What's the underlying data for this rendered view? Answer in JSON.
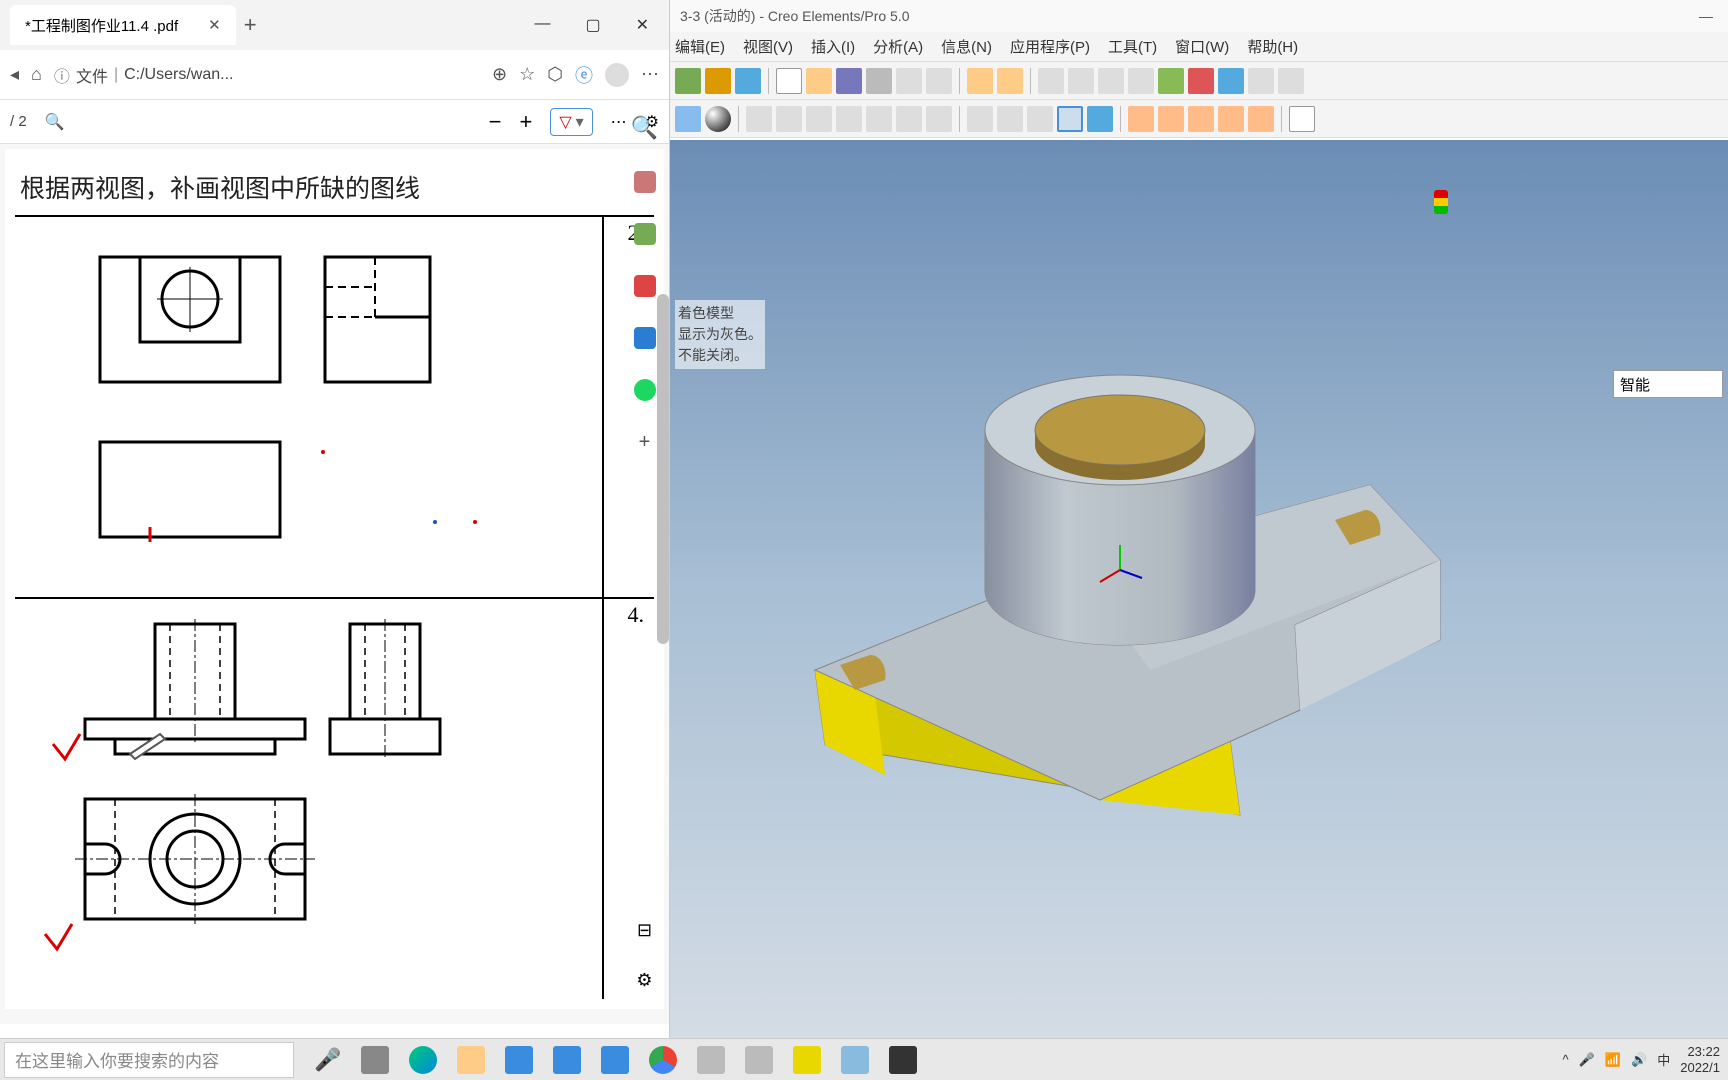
{
  "pdf": {
    "tab_title": "*工程制图作业11.4 .pdf",
    "address_prefix": "文件",
    "address_path": "C:/Users/wan...",
    "page_indicator": "/ 2",
    "heading": "根据两视图，补画视图中所缺的图线",
    "problem_2": "2.",
    "problem_4": "4."
  },
  "creo": {
    "title": "3-3 (活动的) - Creo Elements/Pro 5.0",
    "menus": [
      "编辑(E)",
      "视图(V)",
      "插入(I)",
      "分析(A)",
      "信息(N)",
      "应用程序(P)",
      "工具(T)",
      "窗口(W)",
      "帮助(H)"
    ],
    "info_line1": "着色模型",
    "info_line2": "显示为灰色。",
    "info_line3": "不能关闭。",
    "smart_label": "智能"
  },
  "taskbar": {
    "search_placeholder": "在这里输入你要搜索的内容",
    "ime": "中",
    "time": "23:22",
    "date": "2022/1"
  },
  "colors": {
    "model_gray": "#a8b0b8",
    "model_yellow": "#e8d800",
    "model_hole": "#b89840"
  }
}
